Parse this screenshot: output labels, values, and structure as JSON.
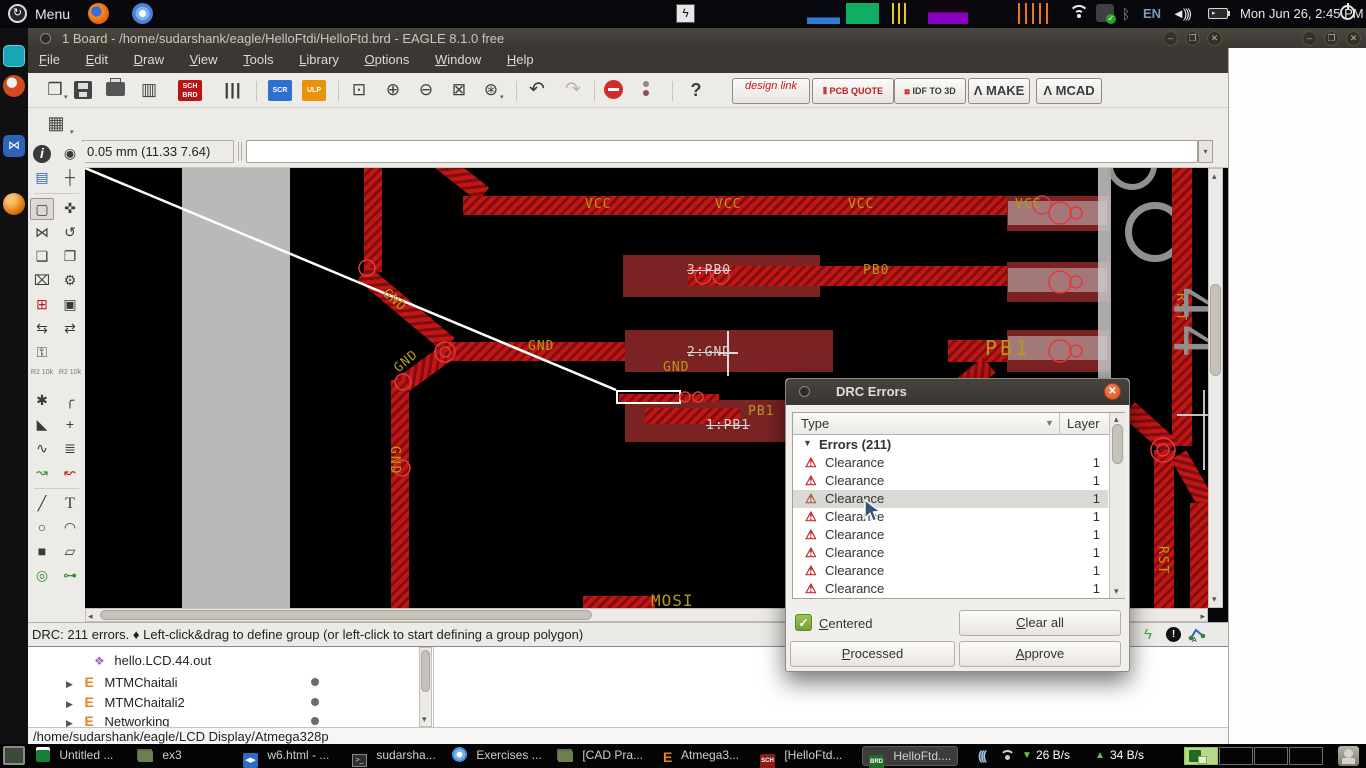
{
  "panel": {
    "menu": "Menu",
    "lang": "EN",
    "clock": "Mon Jun 26, 2:45 PM"
  },
  "eagle": {
    "title": "1 Board - /home/sudarshank/eagle/HelloFtdi/HelloFtd.brd - EAGLE 8.1.0 free",
    "menus": [
      "File",
      "Edit",
      "Draw",
      "View",
      "Tools",
      "Library",
      "Options",
      "Window",
      "Help"
    ],
    "actions": [
      "design link",
      "PCB QUOTE",
      "IDF TO 3D",
      "MAKE",
      "MCAD"
    ],
    "coord": "0.05 mm (11.33 7.64)",
    "command": "",
    "status": "DRC: 211 errors.  ♦ Left-click&drag to define group (or left-click to start defining a group polygon)"
  },
  "toolbar": {
    "icons": [
      {
        "name": "open-icon",
        "glyph": "❒"
      },
      {
        "name": "export-image-icon",
        "glyph": "▥"
      },
      {
        "name": "sch-brd-icon",
        "glyph": "SCH BRD"
      },
      {
        "name": "library-icon",
        "glyph": "|||"
      },
      {
        "name": "script-icon",
        "glyph": "SCR"
      },
      {
        "name": "ulp-icon",
        "glyph": "ULP"
      },
      {
        "name": "zoom-fit-icon",
        "glyph": "⊡"
      },
      {
        "name": "zoom-in-icon",
        "glyph": "⊕"
      },
      {
        "name": "zoom-out-icon",
        "glyph": "⊖"
      },
      {
        "name": "zoom-select-icon",
        "glyph": "⊠"
      },
      {
        "name": "zoom-redraw-icon",
        "glyph": "⊛"
      },
      {
        "name": "undo-icon",
        "glyph": "↶"
      },
      {
        "name": "redo-icon",
        "glyph": "↷"
      },
      {
        "name": "help-icon",
        "glyph": "?"
      },
      {
        "name": "grid-icon",
        "glyph": "▦"
      }
    ]
  },
  "palette": {
    "items": [
      {
        "name": "info-icon",
        "glyph": "i"
      },
      {
        "name": "eye-icon",
        "glyph": "◉"
      },
      {
        "name": "layers-icon",
        "glyph": "▤"
      },
      {
        "name": "mark-icon",
        "glyph": "┼"
      },
      {
        "name": "group-icon",
        "glyph": "▢"
      },
      {
        "name": "move-icon",
        "glyph": "✜"
      },
      {
        "name": "mirror-icon",
        "glyph": "⋈"
      },
      {
        "name": "rotate-icon",
        "glyph": "↺"
      },
      {
        "name": "copy-icon",
        "glyph": "❏"
      },
      {
        "name": "paste-icon",
        "glyph": "❐"
      },
      {
        "name": "delete-icon",
        "glyph": "⌧"
      },
      {
        "name": "change-icon",
        "glyph": "⚙"
      },
      {
        "name": "add-device-icon",
        "glyph": "⊞"
      },
      {
        "name": "add-module-icon",
        "glyph": "▣"
      },
      {
        "name": "pinswap-icon",
        "glyph": "⇆"
      },
      {
        "name": "gateswap-icon",
        "glyph": "⇄"
      },
      {
        "name": "lock-icon",
        "glyph": "⚿"
      },
      {
        "name": "name-icon",
        "glyph": "R2 10k"
      },
      {
        "name": "value-icon",
        "glyph": "R2 10k"
      },
      {
        "name": "smash-icon",
        "glyph": "✱"
      },
      {
        "name": "miter-icon",
        "glyph": "╭"
      },
      {
        "name": "split-icon",
        "glyph": "◣"
      },
      {
        "name": "optimize-icon",
        "glyph": "+"
      },
      {
        "name": "meander-icon",
        "glyph": "∿"
      },
      {
        "name": "align-icon",
        "glyph": "≣"
      },
      {
        "name": "route-icon",
        "glyph": "↝"
      },
      {
        "name": "ripup-icon",
        "glyph": "↜"
      },
      {
        "name": "wire-icon",
        "glyph": "╱"
      },
      {
        "name": "text-icon",
        "glyph": "T"
      },
      {
        "name": "circle-icon",
        "glyph": "○"
      },
      {
        "name": "arc-icon",
        "glyph": "◠"
      },
      {
        "name": "rect-icon",
        "glyph": "■"
      },
      {
        "name": "polygon-icon",
        "glyph": "▱"
      },
      {
        "name": "via-icon",
        "glyph": "◎"
      },
      {
        "name": "signal-icon",
        "glyph": "⊶"
      }
    ]
  },
  "board": {
    "labels": [
      "VCC",
      "VCC",
      "VCC",
      "VCC",
      "3:PB0",
      "PB0",
      "2:GND",
      "GND",
      "GND",
      "GND",
      "GND",
      "GND",
      "PB1",
      "PB1",
      "1:PB1",
      "MOSI",
      "RST",
      "RST",
      "44"
    ]
  },
  "drc": {
    "title": "DRC Errors",
    "col_type": "Type",
    "col_layer": "Layer",
    "group": "Errors (211)",
    "rows": [
      {
        "type": "Clearance",
        "layer": "1"
      },
      {
        "type": "Clearance",
        "layer": "1"
      },
      {
        "type": "Clearance",
        "layer": "1"
      },
      {
        "type": "Clearance",
        "layer": "1"
      },
      {
        "type": "Clearance",
        "layer": "1"
      },
      {
        "type": "Clearance",
        "layer": "1"
      },
      {
        "type": "Clearance",
        "layer": "1"
      },
      {
        "type": "Clearance",
        "layer": "1"
      },
      {
        "type": "Clearance",
        "layer": "1"
      }
    ],
    "centered": "Centered",
    "clear": "Clear all",
    "processed": "Processed",
    "approve": "Approve"
  },
  "control_panel": {
    "items": [
      {
        "label": "hello.LCD.44.out"
      },
      {
        "label": "MTMChaitali"
      },
      {
        "label": "MTMChaitali2"
      },
      {
        "label": "Networking"
      }
    ],
    "path": "/home/sudarshank/eagle/LCD Display/Atmega328p"
  },
  "taskbar": {
    "items": [
      {
        "label": "Untitled ..."
      },
      {
        "label": "ex3"
      },
      {
        "label": "w6.html - ..."
      },
      {
        "label": "sudarsha..."
      },
      {
        "label": "Exercises ..."
      },
      {
        "label": "[CAD Pra..."
      },
      {
        "label": "Atmega3..."
      },
      {
        "label": "[HelloFtd..."
      },
      {
        "label": "HelloFtd...."
      }
    ],
    "net_down": "26 B/s",
    "net_up": "34 B/s"
  }
}
